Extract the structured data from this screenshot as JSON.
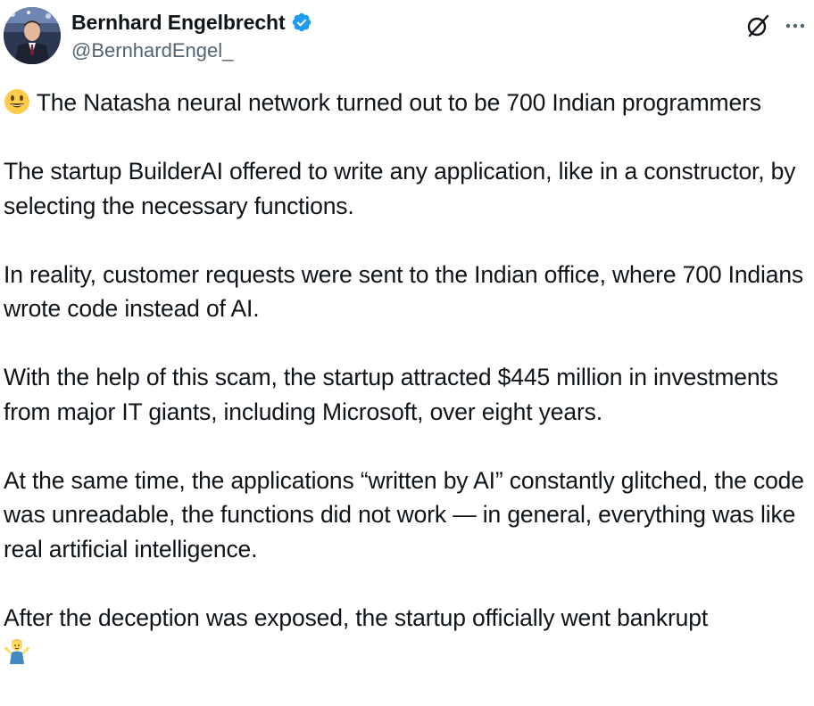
{
  "author": {
    "display_name": "Bernhard Engelbrecht",
    "handle": "@BernhardEngel_",
    "verified": true,
    "avatar_icon": "avatar-portrait"
  },
  "actions": {
    "grok_icon": "grok-icon",
    "more_icon": "more-horizontal-icon"
  },
  "colors": {
    "text": "#0f1419",
    "secondary": "#536471",
    "verified_blue": "#1d9bf0",
    "background": "#ffffff"
  },
  "tweet": {
    "p1": " The Natasha neural network turned out to be 700 Indian programmers",
    "p2": "The startup BuilderAI offered to write any application, like in a constructor, by selecting the necessary functions.",
    "p3": "In reality, customer requests were sent to the Indian office, where 700 Indians wrote code instead of AI.",
    "p4": "With the help of this scam, the startup attracted $445 million in investments from major IT giants, including Microsoft, over eight years.",
    "p5": "At the same time, the applications “written by AI” constantly glitched, the code was unreadable, the functions did not work — in general, everything was like real artificial intelligence.",
    "p6": "After the deception was exposed, the startup officially went bankrupt",
    "p1_emoji": "smiley-face-emoji",
    "p6_emoji": "person-shrugging-emoji"
  }
}
